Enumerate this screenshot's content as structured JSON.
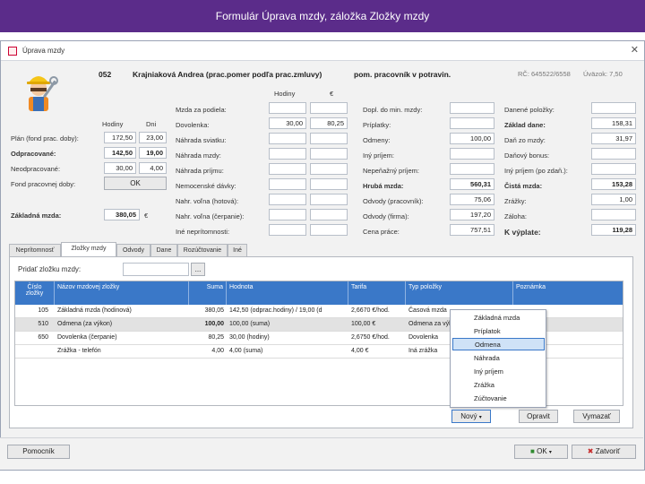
{
  "slide_title": "Formulár Úprava mzdy, záložka Zložky mzdy",
  "window": {
    "title": "Úprava mzdy",
    "close_glyph": "✕"
  },
  "header": {
    "number": "052",
    "employee": "Krajniaková Andrea (prac.pomer podľa prac.zmluvy)",
    "category": "pom. pracovník v potravin.",
    "rc": "RČ: 645522/6558",
    "uvazok": "Úväzok: 7,50"
  },
  "left": {
    "col_hodiny": "Hodiny",
    "col_dni": "Dni",
    "rows": [
      {
        "label": "Plán (fond prac. doby):",
        "hodiny": "172,50",
        "dni": "23,00"
      },
      {
        "label": "Odpracované:",
        "hodiny": "142,50",
        "dni": "19,00"
      },
      {
        "label": "Neodpracované:",
        "hodiny": "30,00",
        "dni": "4,00"
      }
    ],
    "fond_label": "Fond pracovnej doby:",
    "ok_label": "OK",
    "zakladna_label": "Základná mzda:",
    "zakladna_value": "380,05",
    "currency": "€"
  },
  "mid": {
    "col_hodiny": "Hodiny",
    "col_eur": "€",
    "rows": [
      {
        "label": "Mzda za podiela:",
        "hodiny": "",
        "eur": ""
      },
      {
        "label": "Dovolenka:",
        "hodiny": "30,00",
        "eur": "80,25"
      },
      {
        "label": "Náhrada sviatku:",
        "hodiny": "",
        "eur": ""
      },
      {
        "label": "Náhrada mzdy:",
        "hodiny": "",
        "eur": ""
      },
      {
        "label": "Náhrada príjmu:",
        "hodiny": "",
        "eur": ""
      },
      {
        "label": "Nemocenské dávky:",
        "hodiny": "",
        "eur": ""
      },
      {
        "label": "Nahr. voľna (hotová):",
        "hodiny": "",
        "eur": ""
      },
      {
        "label": "Nahr. voľna (čerpanie):",
        "hodiny": "",
        "eur": ""
      },
      {
        "label": "Iné neprítomnosti:",
        "hodiny": "",
        "eur": ""
      }
    ]
  },
  "right1": {
    "rows": [
      {
        "label": "Dopl. do min. mzdy:",
        "value": "",
        "bold": false
      },
      {
        "label": "Príplatky:",
        "value": "",
        "bold": false
      },
      {
        "label": "Odmeny:",
        "value": "100,00",
        "bold": false
      },
      {
        "label": "Iný príjem:",
        "value": "",
        "bold": false
      },
      {
        "label": "Nepeňažný príjem:",
        "value": "",
        "bold": false
      },
      {
        "label": "Hrubá mzda:",
        "value": "560,31",
        "bold": true
      },
      {
        "label": "Odvody (pracovník):",
        "value": "75,06",
        "bold": false
      },
      {
        "label": "Odvody (firma):",
        "value": "197,20",
        "bold": false
      },
      {
        "label": "Cena práce:",
        "value": "757,51",
        "bold": false
      }
    ]
  },
  "right2": {
    "rows": [
      {
        "label": "Danené položky:",
        "value": "",
        "bold": false
      },
      {
        "label": "Základ dane:",
        "value": "158,31",
        "bold": false
      },
      {
        "label": "Daň zo mzdy:",
        "value": "31,97",
        "bold": false
      },
      {
        "label": "Daňový bonus:",
        "value": "",
        "bold": false
      },
      {
        "label": "Iný príjem (po zdaň.):",
        "value": "",
        "bold": false
      },
      {
        "label": "Čistá mzda:",
        "value": "153,28",
        "bold": true
      },
      {
        "label": "Zrážky:",
        "value": "1,00",
        "bold": false
      },
      {
        "label": "Záloha:",
        "value": "",
        "bold": false
      },
      {
        "label": "K výplate:",
        "value": "119,28",
        "bold": true
      }
    ]
  },
  "tabs": [
    "Neprítomnosť",
    "Zložky mzdy",
    "Odvody",
    "Dane",
    "Rozúčtovanie",
    "Iné"
  ],
  "add_component": {
    "label": "Pridať zložku mzdy:",
    "value": "",
    "browse": "..."
  },
  "grid": {
    "columns": [
      "Číslo zložky",
      "Názov mzdovej zložky",
      "Suma",
      "Hodnota",
      "Tarifa",
      "Typ položky",
      "Poznámka"
    ],
    "rows": [
      [
        "105",
        "Základná mzda (hodinová)",
        "380,05",
        "142,50 (odprac.hodiny) / 19,00 (d",
        "2,6670 €/hod.",
        "Časová mzda",
        ""
      ],
      [
        "510",
        "Odmena (za výkon)",
        "100,00",
        "100,00 (suma)",
        "100,00 €",
        "Odmena za výkon",
        ""
      ],
      [
        "650",
        "Dovolenka (čerpanie)",
        "80,25",
        "30,00 (hodiny)",
        "2,6750 €/hod.",
        "Dovolenka",
        ""
      ],
      [
        "",
        "Zrážka - telefón",
        "4,00",
        "4,00 (suma)",
        "4,00 €",
        "Iná zrážka",
        ""
      ]
    ]
  },
  "dropdown": {
    "items": [
      "Základná mzda",
      "Príplatok",
      "Odmena",
      "Náhrada",
      "Iný príjem",
      "Zrážka",
      "Zúčtovanie"
    ],
    "highlighted": 2
  },
  "grid_buttons": {
    "new": "Nový",
    "edit": "Opravit",
    "delete": "Vymazať"
  },
  "bottom": {
    "help": "Pomocník",
    "ok": "OK",
    "close": "Zatvoriť"
  }
}
